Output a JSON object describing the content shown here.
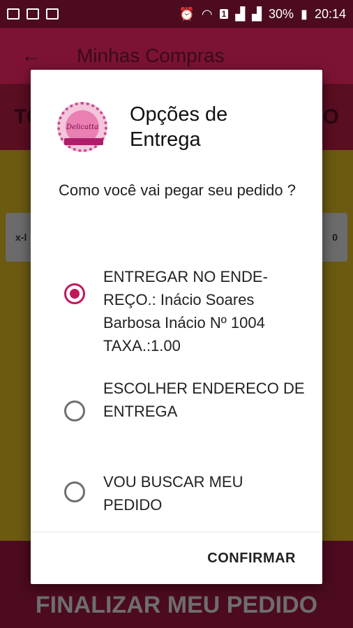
{
  "status_bar": {
    "battery": "30%",
    "time": "20:14",
    "notification_count": "1"
  },
  "app_bar": {
    "title": "Minhas Compras"
  },
  "background": {
    "total_left": "TO",
    "total_right": "O",
    "item_left": "x-l",
    "item_right": "0",
    "finish_button": "FINALIZAR MEU PEDIDO"
  },
  "dialog": {
    "title": "Opções de Entrega",
    "logo_text": "Delicatta",
    "question": "Como você vai pegar seu pedido ?",
    "options": [
      {
        "label": "ENTREGAR NO ENDE-REÇO.: Inácio Soares Barbosa Inácio  Nº 1004  TAXA.:1.00",
        "selected": true
      },
      {
        "label": "ESCOLHER ENDERECO DE ENTREGA",
        "selected": false
      },
      {
        "label": "VOU BUSCAR MEU PEDIDO",
        "selected": false
      }
    ],
    "confirm_label": "CONFIRMAR"
  },
  "colors": {
    "accent": "#c2185b",
    "app_bar": "#7d1333"
  }
}
